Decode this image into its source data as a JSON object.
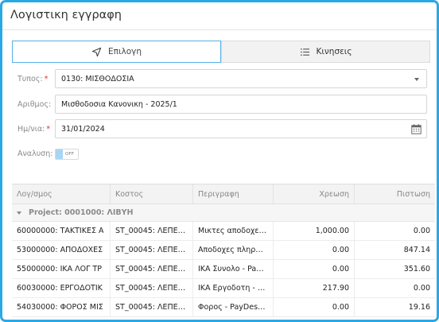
{
  "window": {
    "title": "Λογιστικη εγγραφη"
  },
  "tabs": [
    {
      "label": "Επιλογη",
      "icon": "send-arrow-icon",
      "active": true
    },
    {
      "label": "Κινησεις",
      "icon": "list-icon",
      "active": false
    }
  ],
  "form": {
    "type": {
      "label": "Τυπος:",
      "required": "*",
      "value": "0130: ΜΙΣΘΟΔΟΣΙΑ"
    },
    "number": {
      "label": "Αριθμος:",
      "value": "Μισθοδοσια Κανονικη - 2025/1"
    },
    "date": {
      "label": "Ημ/νια:",
      "required": "*",
      "value": "31/01/2024"
    },
    "analysis": {
      "label": "Αναλυση:",
      "toggle_text": "OFF"
    }
  },
  "grid": {
    "columns": [
      "Λογ/σμος",
      "Κοστος",
      "Περιγραφη",
      "Χρεωση",
      "Πιστωση"
    ],
    "group": "Project: 0001000: ΛΙΒΥΗ",
    "rows": [
      {
        "account": "60000000: ΤΑΚΤΙΚΕΣ Α",
        "cost": "ST_00045: ΛΕΠΕΝΟ...",
        "description": "Μικτες αποδοχες -...",
        "debit": "1,000.00",
        "credit": "0.00"
      },
      {
        "account": "53000000: ΑΠΟΔΟΧΕΣ",
        "cost": "ST_00045: ΛΕΠΕΝΟ...",
        "description": "Αποδοχες πληρωτ...",
        "debit": "0.00",
        "credit": "847.14"
      },
      {
        "account": "55000000: ΙΚΑ ΛΟΓ ΤΡ",
        "cost": "ST_00045: ΛΕΠΕΝΟ...",
        "description": "ΙΚΑ Συνολο - PayD...",
        "debit": "0.00",
        "credit": "351.60"
      },
      {
        "account": "60030000: ΕΡΓΟΔΟΤΙΚ",
        "cost": "ST_00045: ΛΕΠΕΝΟ...",
        "description": "ΙΚΑ Εργοδοτη - Pa...",
        "debit": "217.90",
        "credit": "0.00"
      },
      {
        "account": "54030000: ΦΟΡΟΣ ΜΙΣ",
        "cost": "ST_00045: ΛΕΠΕΝΟ...",
        "description": "Φορος - PayDescTa...",
        "debit": "0.00",
        "credit": "19.16"
      }
    ]
  },
  "colors": {
    "frame": "#2aa8e6",
    "accent": "#55b1e6",
    "required": "#e0322b"
  }
}
